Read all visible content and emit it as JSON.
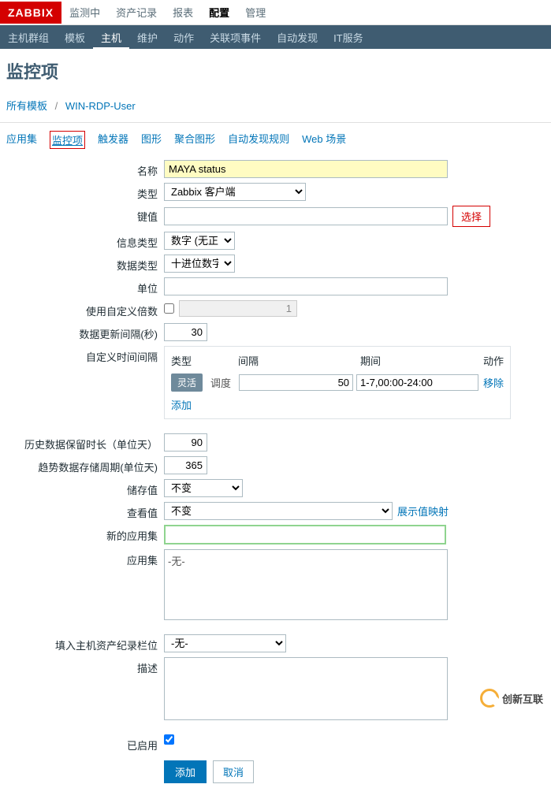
{
  "logo": "ZABBIX",
  "topnav": [
    "监测中",
    "资产记录",
    "报表",
    "配置",
    "管理"
  ],
  "topnav_active": 3,
  "subnav": [
    "主机群组",
    "模板",
    "主机",
    "维护",
    "动作",
    "关联项事件",
    "自动发现",
    "IT服务"
  ],
  "subnav_active": 2,
  "page_title": "监控项",
  "breadcrumb": {
    "all_templates": "所有模板",
    "current": "WIN-RDP-User"
  },
  "tabs": [
    "应用集",
    "监控项",
    "触发器",
    "图形",
    "聚合图形",
    "自动发现规则",
    "Web 场景"
  ],
  "tabs_active": 1,
  "form": {
    "name": {
      "label": "名称",
      "value": "MAYA status"
    },
    "type": {
      "label": "类型",
      "value": "Zabbix 客户端"
    },
    "key": {
      "label": "键值",
      "value": "",
      "select_btn": "选择"
    },
    "info_type": {
      "label": "信息类型",
      "value": "数字 (无正负)"
    },
    "data_type": {
      "label": "数据类型",
      "value": "十进位数字"
    },
    "unit": {
      "label": "单位",
      "value": ""
    },
    "multiplier": {
      "label": "使用自定义倍数",
      "checked": false,
      "value": "1"
    },
    "update_interval": {
      "label": "数据更新间隔(秒)",
      "value": "30"
    },
    "custom_intervals": {
      "label": "自定义时间间隔",
      "headers": {
        "type": "类型",
        "interval": "间隔",
        "period": "期间",
        "action": "动作"
      },
      "row": {
        "active": "灵活",
        "inactive": "调度",
        "interval": "50",
        "period": "1-7,00:00-24:00",
        "remove": "移除"
      },
      "add": "添加"
    },
    "history": {
      "label": "历史数据保留时长（单位天）",
      "value": "90"
    },
    "trends": {
      "label": "趋势数据存储周期(单位天)",
      "value": "365"
    },
    "store_value": {
      "label": "储存值",
      "value": "不变"
    },
    "show_value": {
      "label": "查看值",
      "value": "不变",
      "link": "展示值映射"
    },
    "new_app": {
      "label": "新的应用集",
      "value": ""
    },
    "apps": {
      "label": "应用集",
      "option": "-无-"
    },
    "inventory": {
      "label": "填入主机资产纪录栏位",
      "value": "-无-"
    },
    "description": {
      "label": "描述",
      "value": ""
    },
    "enabled": {
      "label": "已启用",
      "checked": true
    }
  },
  "buttons": {
    "add": "添加",
    "cancel": "取消"
  },
  "watermark": "创新互联"
}
